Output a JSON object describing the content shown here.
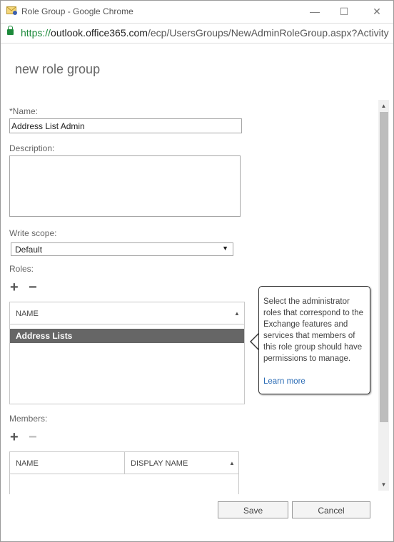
{
  "window": {
    "title": "Role Group - Google Chrome",
    "url_scheme": "https://",
    "url_domain": "outlook.office365.com",
    "url_path": "/ecp/UsersGroups/NewAdminRoleGroup.aspx?Activity",
    "minimize": "—",
    "maximize": "☐",
    "close": "✕"
  },
  "form": {
    "title": "new role group",
    "name_label": "*Name:",
    "name_value": "Address List Admin",
    "description_label": "Description:",
    "description_value": "",
    "write_scope_label": "Write scope:",
    "write_scope_value": "Default",
    "roles_label": "Roles:",
    "members_label": "Members:"
  },
  "roles_grid": {
    "columns": [
      "NAME"
    ],
    "rows": [
      "Address Lists"
    ],
    "selected_row": "Address Lists"
  },
  "members_grid": {
    "columns": [
      "NAME",
      "DISPLAY NAME"
    ],
    "rows": []
  },
  "tooltip": {
    "text": "Select the administrator roles that correspond to the Exchange features and services that members of this role group should have permissions to manage.",
    "link": "Learn more"
  },
  "icons": {
    "add": "+",
    "remove": "−",
    "sort_asc": "▲",
    "dropdown": "▼",
    "scroll_up": "▲",
    "scroll_down": "▼"
  },
  "buttons": {
    "save": "Save",
    "cancel": "Cancel"
  },
  "colors": {
    "selected_row": "#666666",
    "link": "#2b6cb5",
    "lock": "#1d8a3b"
  }
}
